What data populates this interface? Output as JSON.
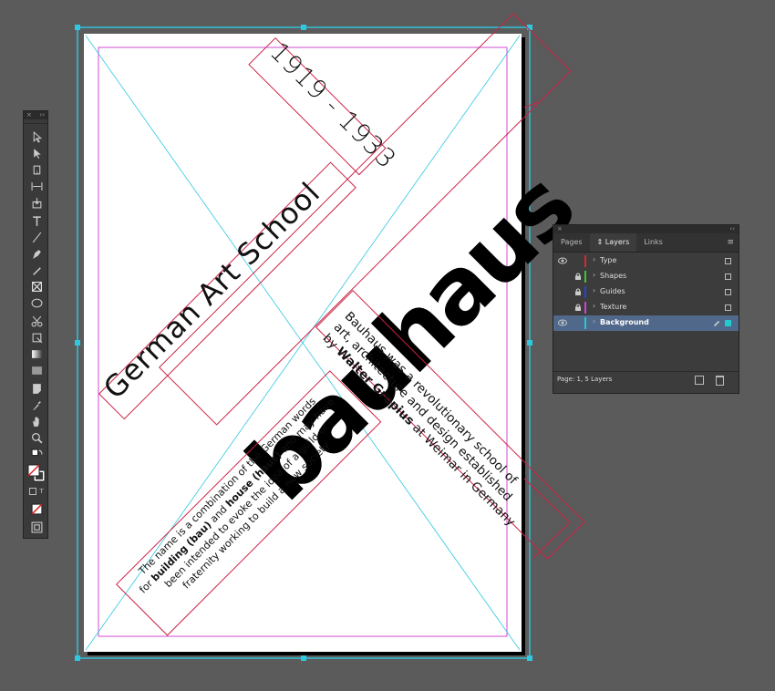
{
  "tools_panel": {
    "header_close": "×",
    "header_collapse": "››",
    "tools": [
      "selection-icon",
      "direct-selection-icon",
      "page-tool-icon",
      "gap-tool-icon",
      "content-collector-icon",
      "type-tool-icon",
      "line-tool-icon",
      "pen-tool-icon",
      "pencil-tool-icon",
      "rectangle-frame-icon",
      "ellipse-tool-icon",
      "scissors-icon",
      "free-transform-icon",
      "gradient-swatch-icon",
      "gradient-feather-icon",
      "note-icon",
      "eyedropper-icon",
      "hand-icon",
      "zoom-icon"
    ],
    "format_text_label": "T"
  },
  "poster": {
    "years": "1919 - 1933",
    "subtitle": "German Art School",
    "headline": "bauhaus",
    "description_lines": [
      "Bauhaus was a revolutionary school of",
      "art, architecture and design established",
      "by ",
      "Walter Gropius",
      " at Weimar in Germany"
    ],
    "note_line1_a": "The name is a combination of the German words",
    "note_line2_a": "for ",
    "note_line2_b": "building (bau)",
    "note_line2_c": " and ",
    "note_line2_d": "house (haus)",
    "note_line2_e": " and may have",
    "note_line3": "been intended to evoke the idea of a guild or",
    "note_line4": "fraternity working to build a new society"
  },
  "layers_panel": {
    "close": "×",
    "collapse": "‹‹",
    "tabs": [
      {
        "label": "Pages",
        "active": false
      },
      {
        "label": "⇕ Layers",
        "active": true
      },
      {
        "label": "Links",
        "active": false
      }
    ],
    "menu_icon": "≡",
    "layers": [
      {
        "name": "Type",
        "visible": true,
        "locked": false,
        "color": "#d42a2a",
        "selected": false
      },
      {
        "name": "Shapes",
        "visible": false,
        "locked": true,
        "color": "#3cc23c",
        "selected": false
      },
      {
        "name": "Guides",
        "visible": false,
        "locked": true,
        "color": "#2244dd",
        "selected": false
      },
      {
        "name": "Texture",
        "visible": false,
        "locked": true,
        "color": "#cc44cc",
        "selected": false
      },
      {
        "name": "Background",
        "visible": true,
        "locked": false,
        "color": "#22cccc",
        "selected": true
      }
    ],
    "status": "Page: 1, 5 Layers"
  },
  "colors": {
    "pasteboard": "#5b5b5b",
    "guide_cyan": "#2ec8e0",
    "margin_magenta": "#d24bd2",
    "frame_red": "#cc2244"
  }
}
